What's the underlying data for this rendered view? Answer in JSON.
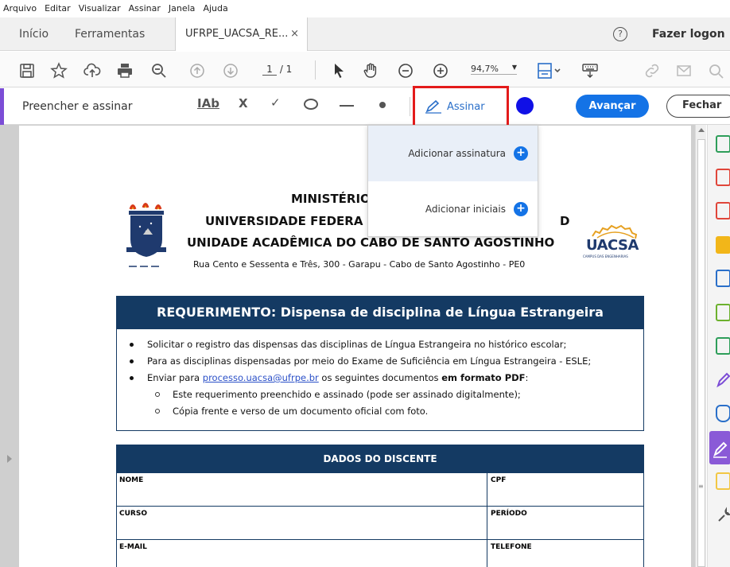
{
  "menu": [
    "Arquivo",
    "Editar",
    "Visualizar",
    "Assinar",
    "Janela",
    "Ajuda"
  ],
  "tabs": {
    "inicio": "Início",
    "ferramentas": "Ferramentas",
    "document": "UFRPE_UACSA_RE...",
    "close": "×"
  },
  "help": "?",
  "logon": "Fazer logon",
  "toolbar": {
    "page_current": "1",
    "page_total": "/ 1",
    "zoom": "94,7%"
  },
  "fill_sign": {
    "title": "Preencher e assinar",
    "text_tool": "IAb",
    "cross_tool": "X",
    "check_tool": "✓",
    "assinar": "Assinar",
    "avancar": "Avançar",
    "fechar": "Fechar",
    "ink_color": "#1010e6"
  },
  "dropdown": {
    "add_signature": "Adicionar assinatura",
    "add_initials": "Adicionar iniciais"
  },
  "document": {
    "line1": "MINISTÉRIO",
    "line2": "UNIVERSIDADE FEDERA",
    "line2_end": "D",
    "line3": "UNIDADE ACADÊMICA DO CABO DE SANTO AGOSTINHO",
    "address": "Rua Cento e Sessenta e Três, 300 - Garapu - Cabo de Santo Agostinho - PE0",
    "logo_right": "UACSA",
    "logo_right_sub": "CAMPUS DAS ENGENHARIAS",
    "banner": "REQUERIMENTO: Dispensa de disciplina de Língua Estrangeira",
    "bullets": {
      "b1": "Solicitar o registro das dispensas das disciplinas de Língua Estrangeira no histórico escolar;",
      "b2": "Para as disciplinas dispensadas por meio do Exame de Suficiência em Língua Estrangeira  - ESLE;",
      "b3_pre": "Enviar para ",
      "b3_link": "processo.uacsa@ufrpe.br",
      "b3_mid": " os seguintes documentos ",
      "b3_bold": "em formato PDF",
      "b3_end": ":",
      "s1": "Este requerimento preenchido e assinado (pode ser assinado digitalmente);",
      "s2": "Cópia frente e verso de um documento oficial com foto."
    },
    "section_title": "DADOS DO DISCENTE",
    "fields": {
      "nome": "NOME",
      "cpf": "CPF",
      "curso": "CURSO",
      "periodo": "PERÍODO",
      "email": "E-MAIL",
      "telefone": "TELEFONE"
    }
  },
  "colors": {
    "brand_blue": "#1473e6",
    "doc_navy": "#143a63",
    "highlight_red": "#e31b1b",
    "accent_purple": "#7c4dd6"
  }
}
